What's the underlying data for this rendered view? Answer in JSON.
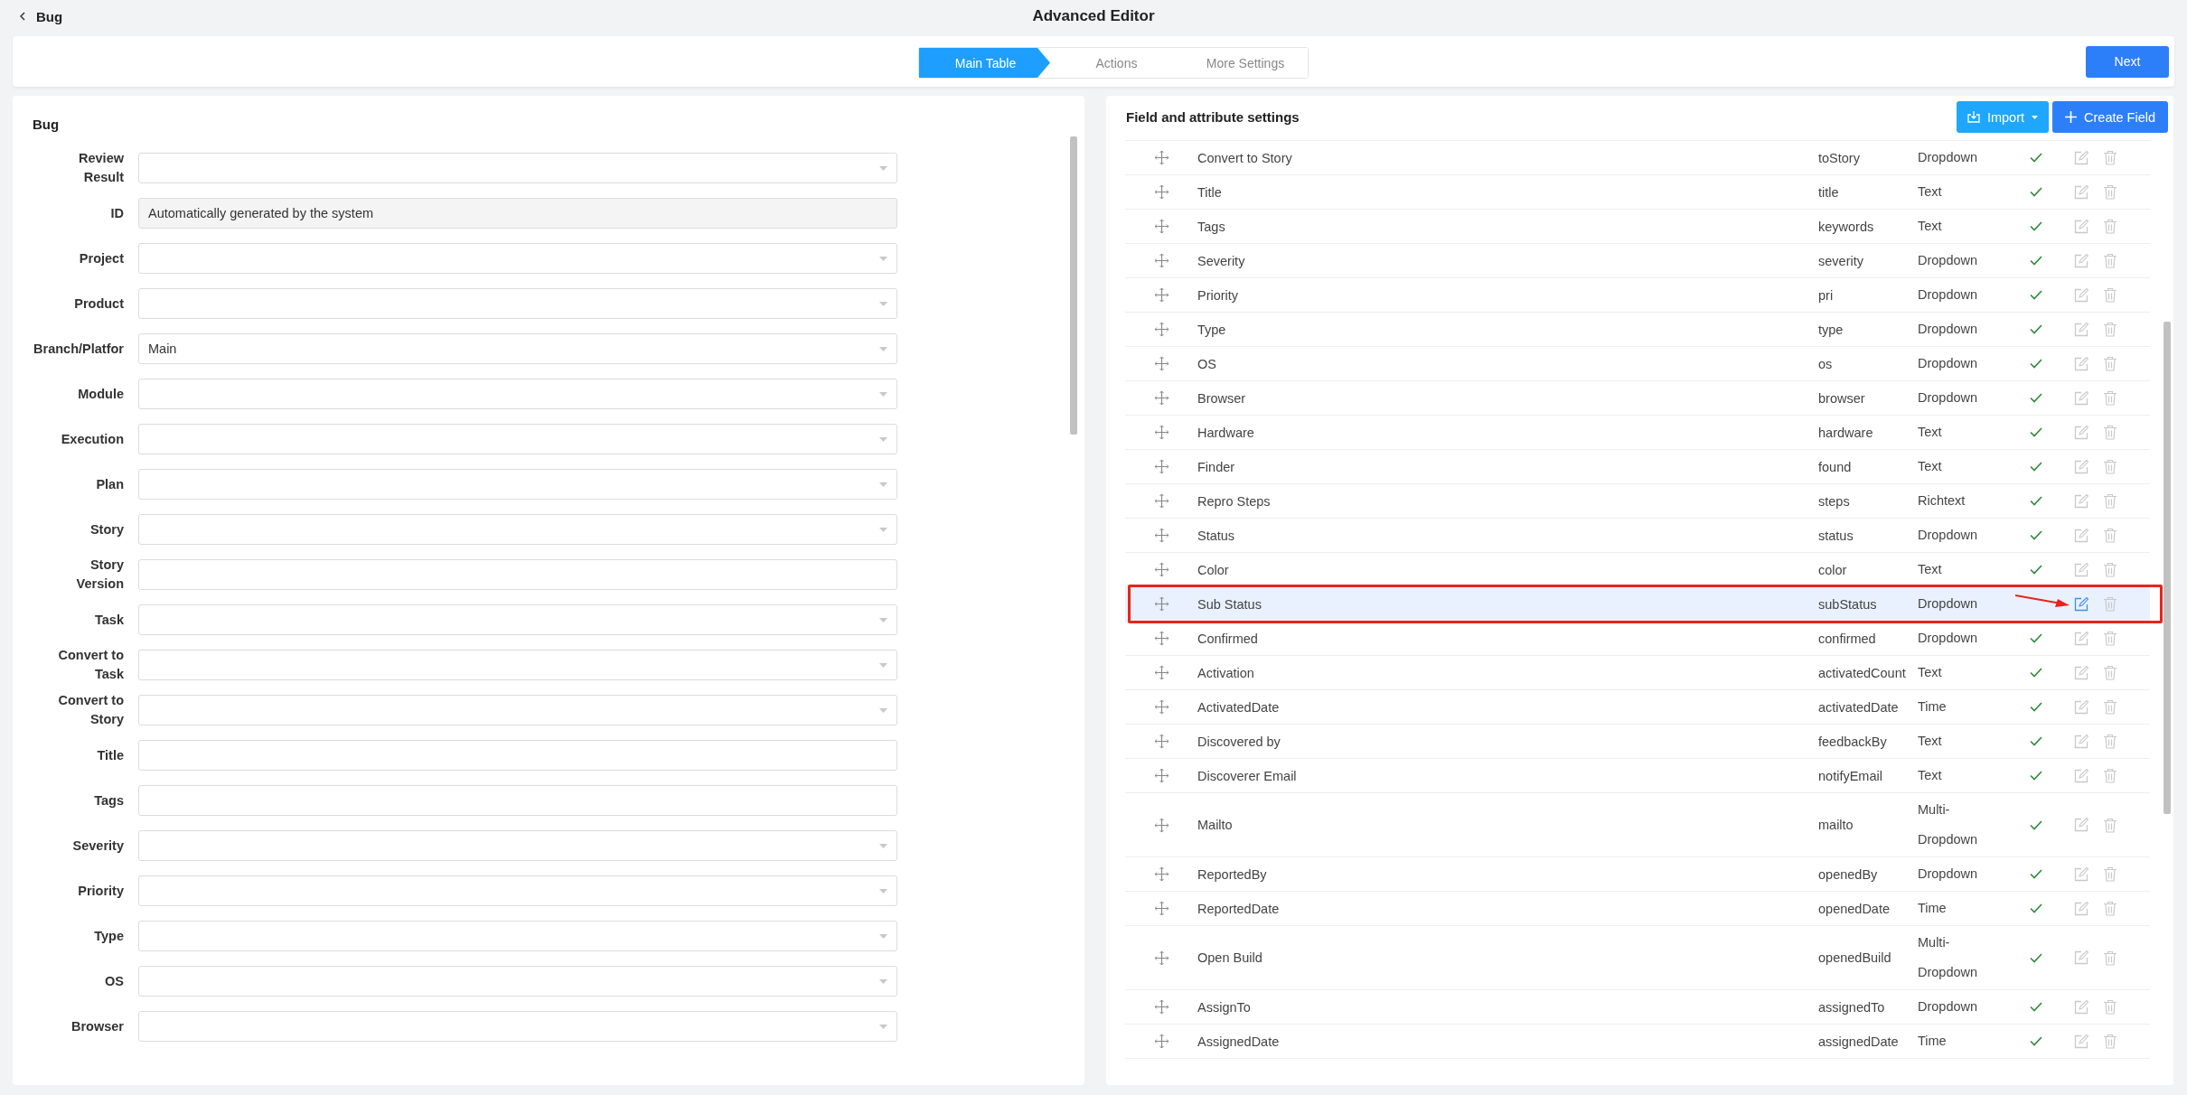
{
  "header": {
    "back_label": "Bug",
    "title": "Advanced Editor"
  },
  "steps": [
    {
      "label": "Main Table",
      "selected": true
    },
    {
      "label": "Actions",
      "selected": false
    },
    {
      "label": "More Settings",
      "selected": false
    }
  ],
  "next_button": "Next",
  "form_panel": {
    "title": "Bug",
    "fields": [
      {
        "label": "Review Result",
        "kind": "select"
      },
      {
        "label": "ID",
        "kind": "readonly",
        "value": "Automatically generated by the system"
      },
      {
        "label": "Project",
        "kind": "select"
      },
      {
        "label": "Product",
        "kind": "select"
      },
      {
        "label": "Branch/Platfor",
        "kind": "select",
        "value": "Main"
      },
      {
        "label": "Module",
        "kind": "select"
      },
      {
        "label": "Execution",
        "kind": "select"
      },
      {
        "label": "Plan",
        "kind": "select"
      },
      {
        "label": "Story",
        "kind": "select"
      },
      {
        "label": "Story Version",
        "kind": "text"
      },
      {
        "label": "Task",
        "kind": "select"
      },
      {
        "label": "Convert to Task",
        "kind": "select"
      },
      {
        "label": "Convert to Story",
        "kind": "select"
      },
      {
        "label": "Title",
        "kind": "text"
      },
      {
        "label": "Tags",
        "kind": "text"
      },
      {
        "label": "Severity",
        "kind": "select"
      },
      {
        "label": "Priority",
        "kind": "select"
      },
      {
        "label": "Type",
        "kind": "select"
      },
      {
        "label": "OS",
        "kind": "select"
      },
      {
        "label": "Browser",
        "kind": "select"
      }
    ]
  },
  "fields_panel": {
    "title": "Field and attribute settings",
    "import_button": "Import",
    "create_button": "Create Field",
    "rows": [
      {
        "name": "Convert to Story",
        "key": "toStory",
        "type": "Dropdown",
        "required": true,
        "selected": false
      },
      {
        "name": "Title",
        "key": "title",
        "type": "Text",
        "required": true,
        "selected": false
      },
      {
        "name": "Tags",
        "key": "keywords",
        "type": "Text",
        "required": true,
        "selected": false
      },
      {
        "name": "Severity",
        "key": "severity",
        "type": "Dropdown",
        "required": true,
        "selected": false
      },
      {
        "name": "Priority",
        "key": "pri",
        "type": "Dropdown",
        "required": true,
        "selected": false
      },
      {
        "name": "Type",
        "key": "type",
        "type": "Dropdown",
        "required": true,
        "selected": false
      },
      {
        "name": "OS",
        "key": "os",
        "type": "Dropdown",
        "required": true,
        "selected": false
      },
      {
        "name": "Browser",
        "key": "browser",
        "type": "Dropdown",
        "required": true,
        "selected": false
      },
      {
        "name": "Hardware",
        "key": "hardware",
        "type": "Text",
        "required": true,
        "selected": false
      },
      {
        "name": "Finder",
        "key": "found",
        "type": "Text",
        "required": true,
        "selected": false
      },
      {
        "name": "Repro Steps",
        "key": "steps",
        "type": "Richtext",
        "required": true,
        "selected": false
      },
      {
        "name": "Status",
        "key": "status",
        "type": "Dropdown",
        "required": true,
        "selected": false
      },
      {
        "name": "Color",
        "key": "color",
        "type": "Text",
        "required": true,
        "selected": false
      },
      {
        "name": "Sub Status",
        "key": "subStatus",
        "type": "Dropdown",
        "required": false,
        "selected": true
      },
      {
        "name": "Confirmed",
        "key": "confirmed",
        "type": "Dropdown",
        "required": true,
        "selected": false
      },
      {
        "name": "Activation",
        "key": "activatedCount",
        "type": "Text",
        "required": true,
        "selected": false
      },
      {
        "name": "ActivatedDate",
        "key": "activatedDate",
        "type": "Time",
        "required": true,
        "selected": false
      },
      {
        "name": "Discovered by",
        "key": "feedbackBy",
        "type": "Text",
        "required": true,
        "selected": false
      },
      {
        "name": "Discoverer Email",
        "key": "notifyEmail",
        "type": "Text",
        "required": true,
        "selected": false
      },
      {
        "name": "Mailto",
        "key": "mailto",
        "type": "Multi-Dropdown",
        "required": true,
        "selected": false
      },
      {
        "name": "ReportedBy",
        "key": "openedBy",
        "type": "Dropdown",
        "required": true,
        "selected": false
      },
      {
        "name": "ReportedDate",
        "key": "openedDate",
        "type": "Time",
        "required": true,
        "selected": false
      },
      {
        "name": "Open Build",
        "key": "openedBuild",
        "type": "Multi-Dropdown",
        "required": true,
        "selected": false
      },
      {
        "name": "AssignTo",
        "key": "assignedTo",
        "type": "Dropdown",
        "required": true,
        "selected": false
      },
      {
        "name": "AssignedDate",
        "key": "assignedDate",
        "type": "Time",
        "required": true,
        "selected": false
      }
    ]
  }
}
